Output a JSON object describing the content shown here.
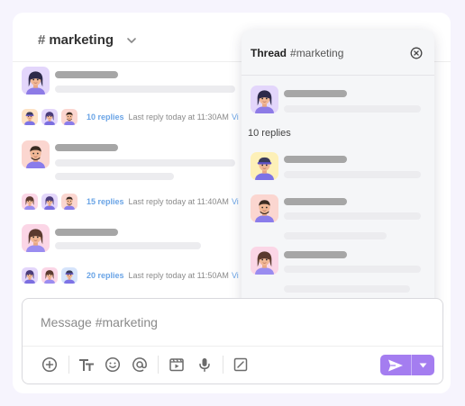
{
  "colors": {
    "accent": "#a47df0",
    "link": "#6aa4e6",
    "page_background": "#f6f4fd",
    "placeholder_bar_dark": "#a6a6a6",
    "placeholder_bar_light": "#ececef"
  },
  "header": {
    "hash": "#",
    "channel": "marketing",
    "dropdown_icon": "chevron-down-icon"
  },
  "messages": [
    {
      "avatar_color": "#e3d6fb",
      "reply_count": "10 replies",
      "last_reply": "Last reply today at 11:30AM",
      "more": "Vi",
      "mini_avatar_colors": [
        "#fde2c4",
        "#e3d6fb",
        "#fbd6d0"
      ]
    },
    {
      "avatar_color": "#fbd6d0",
      "reply_count": "15 replies",
      "last_reply": "Last reply today at 11:40AM",
      "more": "Vi",
      "mini_avatar_colors": [
        "#fbd6e6",
        "#e3d6fb",
        "#fbd6d0"
      ]
    },
    {
      "avatar_color": "#fbd6e6",
      "reply_count": "20 replies",
      "last_reply": "Last reply today at 11:50AM",
      "more": "Vi",
      "mini_avatar_colors": [
        "#e3d6fb",
        "#fbd6e6",
        "#d6e4fb"
      ]
    }
  ],
  "thread": {
    "title": "Thread",
    "channel": "#marketing",
    "close_icon": "close-circle-icon",
    "reply_count": "10 replies",
    "parent_avatar_color": "#e3d6fb",
    "reply_avatar_colors": [
      "#fdf0b8",
      "#fbd6d0",
      "#fbd6e6"
    ]
  },
  "composer": {
    "placeholder": "Message #marketing",
    "tools": [
      "add-circle-icon",
      "text-format-icon",
      "emoji-icon",
      "mention-icon",
      "video-clip-icon",
      "microphone-icon",
      "edit-box-icon"
    ],
    "send_icon": "send-icon",
    "send_dropdown_icon": "caret-down-icon"
  }
}
